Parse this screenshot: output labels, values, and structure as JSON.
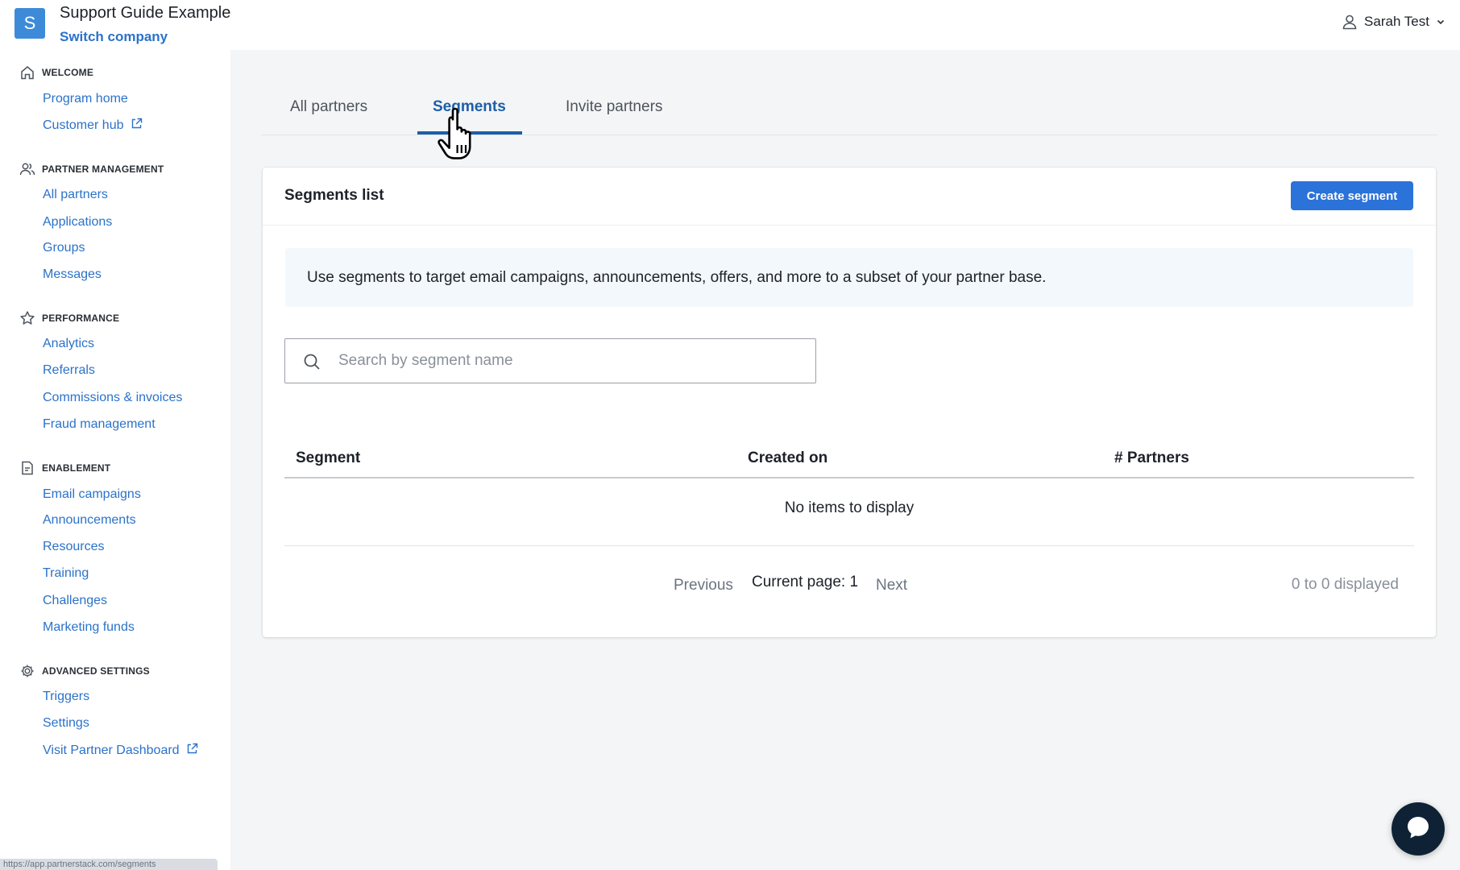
{
  "app": {
    "logo_letter": "S",
    "company_name": "Support Guide Example",
    "switch_company_label": "Switch company",
    "user_name": "Sarah Test"
  },
  "sidebar": {
    "sections": [
      {
        "heading": "WELCOME",
        "icon": "home-icon",
        "items": [
          {
            "label": "Program home"
          },
          {
            "label": "Customer hub",
            "external": true
          }
        ]
      },
      {
        "heading": "PARTNER MANAGEMENT",
        "icon": "users-icon",
        "items": [
          {
            "label": "All partners"
          },
          {
            "label": "Applications"
          },
          {
            "label": "Groups"
          },
          {
            "label": "Messages"
          }
        ]
      },
      {
        "heading": "PERFORMANCE",
        "icon": "star-icon",
        "items": [
          {
            "label": "Analytics"
          },
          {
            "label": "Referrals"
          },
          {
            "label": "Commissions & invoices"
          },
          {
            "label": "Fraud management"
          }
        ]
      },
      {
        "heading": "ENABLEMENT",
        "icon": "document-icon",
        "items": [
          {
            "label": "Email campaigns"
          },
          {
            "label": "Announcements"
          },
          {
            "label": "Resources"
          },
          {
            "label": "Training"
          },
          {
            "label": "Challenges"
          },
          {
            "label": "Marketing funds"
          }
        ]
      },
      {
        "heading": "ADVANCED SETTINGS",
        "icon": "gear-icon",
        "items": [
          {
            "label": "Triggers"
          },
          {
            "label": "Settings"
          },
          {
            "label": "Visit Partner Dashboard",
            "external": true
          }
        ]
      }
    ],
    "status_url": "https://app.partnerstack.com/segments"
  },
  "tabs": [
    {
      "label": "All partners",
      "active": false
    },
    {
      "label": "Segments",
      "active": true
    },
    {
      "label": "Invite partners",
      "active": false
    }
  ],
  "card": {
    "title": "Segments list",
    "create_button_label": "Create segment",
    "info_text": "Use segments to target email campaigns, announcements, offers, and more to a subset of your partner base.",
    "search_placeholder": "Search by segment name",
    "search_value": "",
    "table": {
      "columns": [
        "Segment",
        "Created on",
        "# Partners"
      ],
      "rows": [],
      "empty_text": "No items to display"
    },
    "pagination": {
      "previous_label": "Previous",
      "current_page_text": "Current page: 1",
      "next_label": "Next",
      "count_text": "0 to 0 displayed"
    }
  },
  "colors": {
    "link": "#2b72c9",
    "active_tab": "#1d5fa8",
    "primary_button": "#2b72d9",
    "logo": "#3d8bd8",
    "chat": "#0f2235"
  }
}
